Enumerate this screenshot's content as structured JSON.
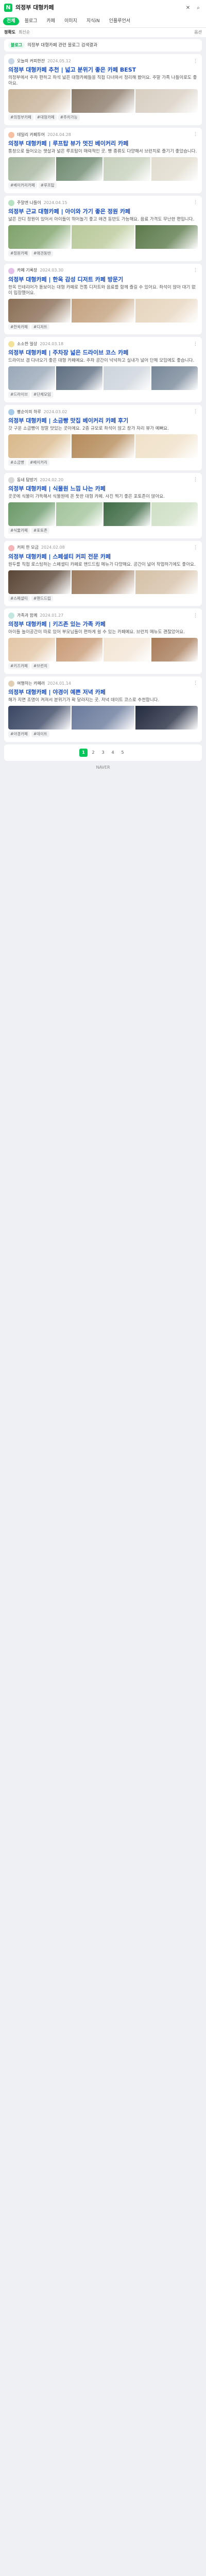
{
  "search": {
    "query": "의정부 대형카페"
  },
  "tabs": [
    "전체",
    "블로그",
    "카페",
    "이미지",
    "지식iN",
    "인플루언서"
  ],
  "sort": {
    "options": [
      "정확도",
      "최신순"
    ],
    "active": 0,
    "filter": "옵션"
  },
  "notice": {
    "pill": "블로그",
    "text": "의정부 대형카페 관련 블로그 검색결과"
  },
  "colors": {
    "accent": "#03c75a",
    "title": "#1a4dbe",
    "highlight": "#03a94d"
  },
  "posts": [
    {
      "author": "오늘의 커피한잔",
      "date": "2024.05.12",
      "title": "의정부 대형카페 추천 | 넓고 분위기 좋은 카페 BEST",
      "desc": "의정부에서 주차 편하고 좌석 넓은 대형카페들을 직접 다녀와서 정리해 봤어요. 주말 가족 나들이로도 좋아요.",
      "thumbs": [
        "#c9b49a",
        "#8c7b6a",
        "#d8cfc2"
      ],
      "tags": [
        "#의정부카페",
        "#대형카페",
        "#주차가능"
      ]
    },
    {
      "author": "데일리 카페투어",
      "date": "2024.04.28",
      "title": "의정부 대형카페 | 루프탑 뷰가 멋진 베이커리 카페",
      "desc": "통창으로 들어오는 햇살과 넓은 루프탑이 매력적인 곳. 빵 종류도 다양해서 브런치로 즐기기 좋았습니다.",
      "thumbs": [
        "#a7b7a0",
        "#6f8a70",
        "#c7d1bd",
        "#e1dccf"
      ],
      "tags": [
        "#베이커리카페",
        "#루프탑"
      ]
    },
    {
      "author": "주말엔 나들이",
      "date": "2024.04.15",
      "title": "의정부 근교 대형카페 | 아이와 가기 좋은 정원 카페",
      "desc": "넓은 잔디 정원이 있어서 아이들이 뛰어놀기 좋고 애견 동반도 가능해요. 음료 가격도 무난한 편입니다.",
      "thumbs": [
        "#7fa36b",
        "#b9c99a",
        "#5c7a4b"
      ],
      "tags": [
        "#정원카페",
        "#애견동반"
      ]
    },
    {
      "author": "카페 기록장",
      "date": "2024.03.30",
      "title": "의정부 대형카페 | 한옥 감성 디저트 카페 방문기",
      "desc": "한옥 인테리어가 돋보이는 대형 카페로 전통 디저트와 음료를 함께 즐길 수 있어요. 좌석이 많아 대기 없이 입장했어요.",
      "thumbs": [
        "#8a6f56",
        "#c4a27f",
        "#e6d5bd"
      ],
      "tags": [
        "#한옥카페",
        "#디저트"
      ]
    },
    {
      "author": "소소한 일상",
      "date": "2024.03.18",
      "title": "의정부 대형카페 | 주차장 넓은 드라이브 코스 카페",
      "desc": "드라이브 겸 다녀오기 좋은 대형 카페예요. 주차 공간이 넉넉하고 실내가 넓어 단체 모임에도 좋습니다.",
      "thumbs": [
        "#9aa8b8",
        "#5f6f82",
        "#cdd4dc",
        "#788899"
      ],
      "tags": [
        "#드라이브",
        "#단체모임"
      ]
    },
    {
      "author": "빵순이의 하루",
      "date": "2024.03.02",
      "title": "의정부 대형카페 | 소금빵 맛집 베이커리 카페 후기",
      "desc": "갓 구운 소금빵이 정말 맛있는 곳이에요. 2층 규모로 좌석이 많고 창가 자리 뷰가 예뻐요.",
      "thumbs": [
        "#d9b98c",
        "#b58b5a",
        "#f0e1c8"
      ],
      "tags": [
        "#소금빵",
        "#베이커리"
      ]
    },
    {
      "author": "동네 탐방기",
      "date": "2024.02.20",
      "title": "의정부 대형카페 | 식물원 느낌 나는 카페",
      "desc": "곳곳에 식물이 가득해서 식물원에 온 듯한 대형 카페. 사진 찍기 좋은 포토존이 많아요.",
      "thumbs": [
        "#6c9a6a",
        "#a3c49b",
        "#3f6b45",
        "#cfe0c6"
      ],
      "tags": [
        "#식물카페",
        "#포토존"
      ]
    },
    {
      "author": "커피 한 모금",
      "date": "2024.02.08",
      "title": "의정부 대형카페 | 스페셜티 커피 전문 카페",
      "desc": "원두를 직접 로스팅하는 스페셜티 카페로 핸드드립 메뉴가 다양해요. 공간이 넓어 작업하기에도 좋아요.",
      "thumbs": [
        "#5b4636",
        "#9c7b5f",
        "#d6c1a8"
      ],
      "tags": [
        "#스페셜티",
        "#핸드드립"
      ]
    },
    {
      "author": "가족과 함께",
      "date": "2024.01.27",
      "title": "의정부 대형카페 | 키즈존 있는 가족 카페",
      "desc": "아이들 놀이공간이 따로 있어 부모님들이 편하게 쉴 수 있는 카페예요. 브런치 메뉴도 괜찮았어요.",
      "thumbs": [
        "#e3c6a6",
        "#c99c77",
        "#f3e6d6",
        "#a97d5b"
      ],
      "tags": [
        "#키즈카페",
        "#브런치"
      ]
    },
    {
      "author": "여행하는 카페러",
      "date": "2024.01.14",
      "title": "의정부 대형카페 | 야경이 예쁜 저녁 카페",
      "desc": "해가 지면 조명이 켜져서 분위기가 확 달라지는 곳. 저녁 데이트 코스로 추천합니다.",
      "thumbs": [
        "#3a4663",
        "#6a7a9c",
        "#242c40"
      ],
      "tags": [
        "#야경카페",
        "#데이트"
      ]
    }
  ],
  "pagination": [
    "1",
    "2",
    "3",
    "4",
    "5"
  ],
  "footer": "NAVER"
}
